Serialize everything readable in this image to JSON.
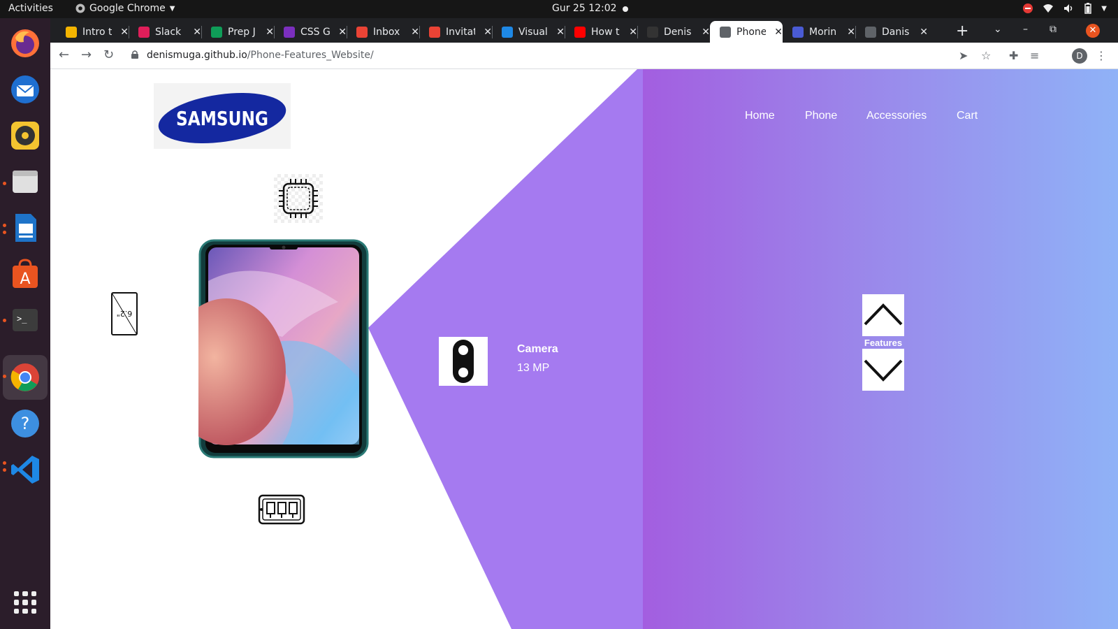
{
  "system": {
    "activities": "Activities",
    "app_name": "Google Chrome",
    "clock": "Gur 25  12:02"
  },
  "browser": {
    "tabs": [
      {
        "label": "Intro t",
        "favicon_color": "#f4b400"
      },
      {
        "label": "Slack |",
        "favicon_color": "#e01e5a"
      },
      {
        "label": "Prep J",
        "favicon_color": "#0f9d58"
      },
      {
        "label": "CSS Gr",
        "favicon_color": "#7b2fbe"
      },
      {
        "label": "Inbox",
        "favicon_color": "#ea4335"
      },
      {
        "label": "Invitat",
        "favicon_color": "#ea4335"
      },
      {
        "label": "Visual",
        "favicon_color": "#1e88e5"
      },
      {
        "label": "How t",
        "favicon_color": "#ff0000"
      },
      {
        "label": "Denis",
        "favicon_color": "#333333"
      },
      {
        "label": "Phone",
        "favicon_color": "#5f6368"
      },
      {
        "label": "Morin",
        "favicon_color": "#4a5bd4"
      },
      {
        "label": "Danis",
        "favicon_color": "#5f6368"
      }
    ],
    "active_tab_index": 9,
    "url_host": "denismuga.github.io",
    "url_path": "/Phone-Features_Website/",
    "profile_initial": "D"
  },
  "page": {
    "logo_text": "SAMSUNG",
    "nav": [
      "Home",
      "Phone",
      "Accessories",
      "Cart"
    ],
    "screen_size_label": "6.2\"",
    "feature": {
      "title": "Camera",
      "value": "13 MP"
    },
    "features_label": "Features",
    "colors": {
      "accent_purple": "#a57af0",
      "gradient_start": "#a35ee0",
      "gradient_end": "#8fb2f7",
      "logo_blue": "#1428a0"
    }
  }
}
